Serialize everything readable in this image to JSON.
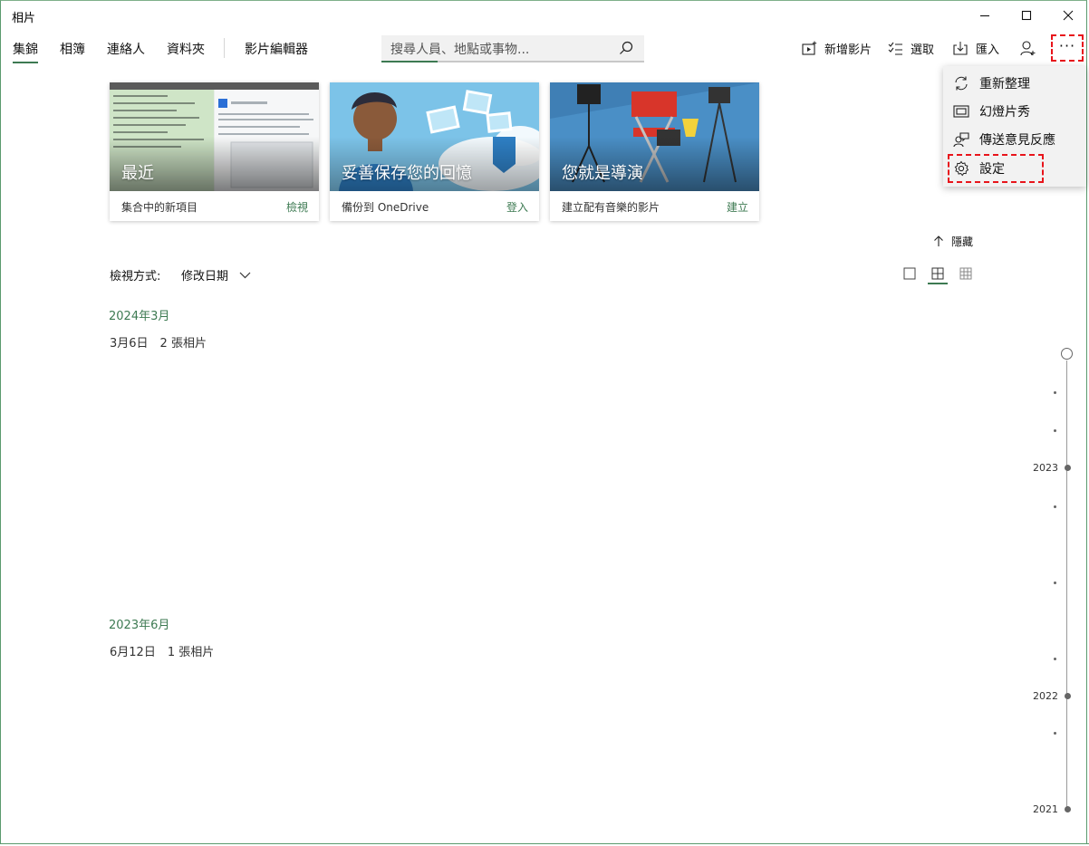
{
  "window": {
    "title": "相片"
  },
  "nav": {
    "tabs": [
      "集錦",
      "相簿",
      "連絡人",
      "資料夾",
      "影片編輯器"
    ]
  },
  "search": {
    "placeholder": "搜尋人員、地點或事物..."
  },
  "toolbar": {
    "new_video": "新增影片",
    "select": "選取",
    "import": "匯入"
  },
  "menu": {
    "items": [
      "重新整理",
      "幻燈片秀",
      "傳送意見反應",
      "設定"
    ]
  },
  "cards": [
    {
      "title": "最近",
      "desc": "集合中的新項目",
      "action": "檢視"
    },
    {
      "title": "妥善保存您的回憶",
      "desc": "備份到 OneDrive",
      "action": "登入"
    },
    {
      "title": "您就是導演",
      "desc": "建立配有音樂的影片",
      "action": "建立"
    }
  ],
  "hide_label": "隱藏",
  "view": {
    "label": "檢視方式:",
    "value": "修改日期"
  },
  "sections": [
    {
      "month": "2024年3月",
      "group": "3月6日　2 張相片"
    },
    {
      "month": "2023年6月",
      "group": "6月12日　1 張相片"
    }
  ],
  "timeline": {
    "years": [
      "2023",
      "2022",
      "2021"
    ]
  },
  "colors": {
    "accent": "#3d7a52",
    "highlight": "#e8141b"
  }
}
